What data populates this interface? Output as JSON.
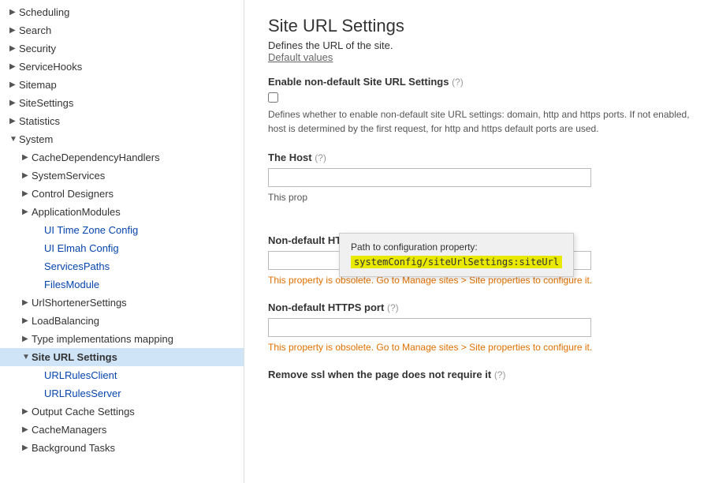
{
  "sidebar": {
    "items": [
      {
        "id": "scheduling",
        "label": "Scheduling",
        "level": 0,
        "arrow": "▶",
        "active": false
      },
      {
        "id": "search",
        "label": "Search",
        "level": 0,
        "arrow": "▶",
        "active": false
      },
      {
        "id": "security",
        "label": "Security",
        "level": 0,
        "arrow": "▶",
        "active": false
      },
      {
        "id": "servicehooks",
        "label": "ServiceHooks",
        "level": 0,
        "arrow": "▶",
        "active": false
      },
      {
        "id": "sitemap",
        "label": "Sitemap",
        "level": 0,
        "arrow": "▶",
        "active": false
      },
      {
        "id": "sitesettings",
        "label": "SiteSettings",
        "level": 0,
        "arrow": "▶",
        "active": false
      },
      {
        "id": "statistics",
        "label": "Statistics",
        "level": 0,
        "arrow": "▶",
        "active": false
      },
      {
        "id": "system",
        "label": "System",
        "level": 0,
        "arrow": "▼",
        "active": false,
        "expanded": true
      },
      {
        "id": "cachedependencyhandlers",
        "label": "CacheDependencyHandlers",
        "level": 1,
        "arrow": "▶",
        "active": false
      },
      {
        "id": "systemservices",
        "label": "SystemServices",
        "level": 1,
        "arrow": "▶",
        "active": false
      },
      {
        "id": "controldesigners",
        "label": "Control Designers",
        "level": 1,
        "arrow": "▶",
        "active": false
      },
      {
        "id": "applicationmodules",
        "label": "ApplicationModules",
        "level": 1,
        "arrow": "▶",
        "active": false
      },
      {
        "id": "uitimezoneconfig",
        "label": "UI Time Zone Config",
        "level": 2,
        "arrow": "",
        "active": false
      },
      {
        "id": "uielmahconfig",
        "label": "UI Elmah Config",
        "level": 2,
        "arrow": "",
        "active": false
      },
      {
        "id": "servicespaths",
        "label": "ServicesPaths",
        "level": 2,
        "arrow": "",
        "active": false
      },
      {
        "id": "filesmodule",
        "label": "FilesModule",
        "level": 2,
        "arrow": "",
        "active": false
      },
      {
        "id": "urlshortenersettings",
        "label": "UrlShortenerSettings",
        "level": 1,
        "arrow": "▶",
        "active": false
      },
      {
        "id": "loadbalancing",
        "label": "LoadBalancing",
        "level": 1,
        "arrow": "▶",
        "active": false
      },
      {
        "id": "typeimplementationsmapping",
        "label": "Type implementations mapping",
        "level": 1,
        "arrow": "▶",
        "active": false
      },
      {
        "id": "siteurlsettings",
        "label": "Site URL Settings",
        "level": 1,
        "arrow": "▼",
        "active": true,
        "expanded": true
      },
      {
        "id": "urlrulesclient",
        "label": "URLRulesClient",
        "level": 2,
        "arrow": "",
        "active": false
      },
      {
        "id": "urlrulesserver",
        "label": "URLRulesServer",
        "level": 2,
        "arrow": "",
        "active": false
      },
      {
        "id": "outputcachesettings",
        "label": "Output Cache Settings",
        "level": 1,
        "arrow": "▶",
        "active": false
      },
      {
        "id": "cachemanagers",
        "label": "CacheManagers",
        "level": 1,
        "arrow": "▶",
        "active": false
      },
      {
        "id": "backgroundtasks",
        "label": "Background Tasks",
        "level": 1,
        "arrow": "▶",
        "active": false
      }
    ]
  },
  "main": {
    "title": "Site URL Settings",
    "subtitle": "Defines the URL of the site.",
    "default_values_link": "Default values",
    "enable_section": {
      "label": "Enable non-default Site URL Settings",
      "help": "(?)",
      "description": "Defines whether to enable non-default site URL settings: domain, http and https ports. If not enabled, host is determined by the first request, for http and https default ports are used."
    },
    "host_section": {
      "label": "The Host",
      "help": "(?)",
      "this_prop_text": "This prop",
      "tooltip": {
        "line1": "Path to configuration property:",
        "path": "systemConfig/siteUrlSettings:siteUrl"
      }
    },
    "http_port_section": {
      "label": "Non-default HTTP port",
      "help": "(?)",
      "obsolete_note": "This property is obsolete. Go to Manage sites > Site properties to configure it."
    },
    "https_port_section": {
      "label": "Non-default HTTPS port",
      "help": "(?)",
      "obsolete_note": "This property is obsolete. Go to Manage sites > Site properties to configure it."
    },
    "remove_ssl_section": {
      "label": "Remove ssl when the page does not require it",
      "help": "(?)"
    }
  }
}
